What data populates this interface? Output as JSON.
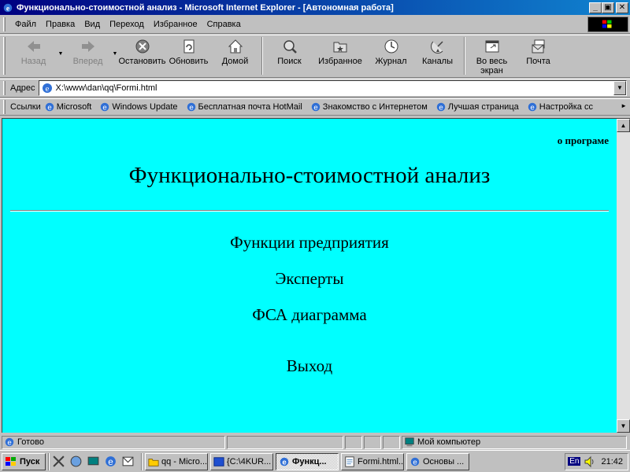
{
  "window": {
    "title": "Функционально-стоимостной анализ - Microsoft Internet Explorer - [Автономная работа]",
    "controls": {
      "minimize": "_",
      "maximize": "▣",
      "close": "✕"
    }
  },
  "menu": {
    "items": [
      "Файл",
      "Правка",
      "Вид",
      "Переход",
      "Избранное",
      "Справка"
    ]
  },
  "toolbar": {
    "back": "Назад",
    "forward": "Вперед",
    "stop": "Остановить",
    "refresh": "Обновить",
    "home": "Домой",
    "search": "Поиск",
    "favorites": "Избранное",
    "history": "Журнал",
    "channels": "Каналы",
    "fullscreen_1": "Во весь",
    "fullscreen_2": "экран",
    "mail": "Почта"
  },
  "address": {
    "label": "Адрес",
    "value": "X:\\www\\dan\\qq\\Formi.html"
  },
  "links": {
    "label": "Ссылки",
    "items": [
      "Microsoft",
      "Windows Update",
      "Бесплатная почта HotMail",
      "Знакомство с Интернетом",
      "Лучшая страница",
      "Настройка сс"
    ]
  },
  "page": {
    "about_link": "о програме",
    "heading": "Функционально-стоимостной анализ",
    "nav": [
      "Функции предприятия",
      "Эксперты",
      "ФСА диаграмма",
      "Выход"
    ]
  },
  "status": {
    "text": "Готово",
    "zone": "Мой компьютер"
  },
  "taskbar": {
    "start": "Пуск",
    "tasks": [
      "qq - Micro...",
      "{C:\\4KUR...",
      "Функц...",
      "Formi.html...",
      "Основы ..."
    ],
    "lang": "En",
    "clock": "21:42"
  }
}
